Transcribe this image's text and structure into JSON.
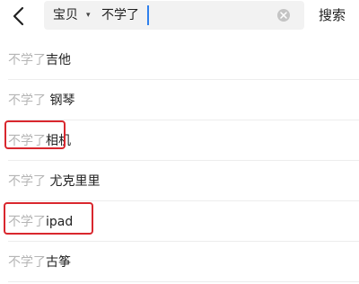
{
  "header": {
    "back_icon": "chevron-left-icon",
    "scope_label": "宝贝",
    "scope_caret": "▾",
    "query": "不学了",
    "clear_icon": "clear-circle-icon",
    "search_button": "搜索"
  },
  "suggestions": [
    {
      "prefix": "不学了",
      "term": "吉他",
      "highlighted": false
    },
    {
      "prefix": "不学了",
      "term": " 钢琴",
      "highlighted": false
    },
    {
      "prefix": "不学了",
      "term": "相机",
      "highlighted": true
    },
    {
      "prefix": "不学了",
      "term": " 尤克里里",
      "highlighted": false
    },
    {
      "prefix": "不学了",
      "term": "ipad",
      "highlighted": true
    },
    {
      "prefix": "不学了",
      "term": "古筝",
      "highlighted": false
    }
  ],
  "colors": {
    "highlight_border": "#d9272e",
    "caret": "#2f80ed",
    "prefix_text": "#b5b5b5"
  }
}
